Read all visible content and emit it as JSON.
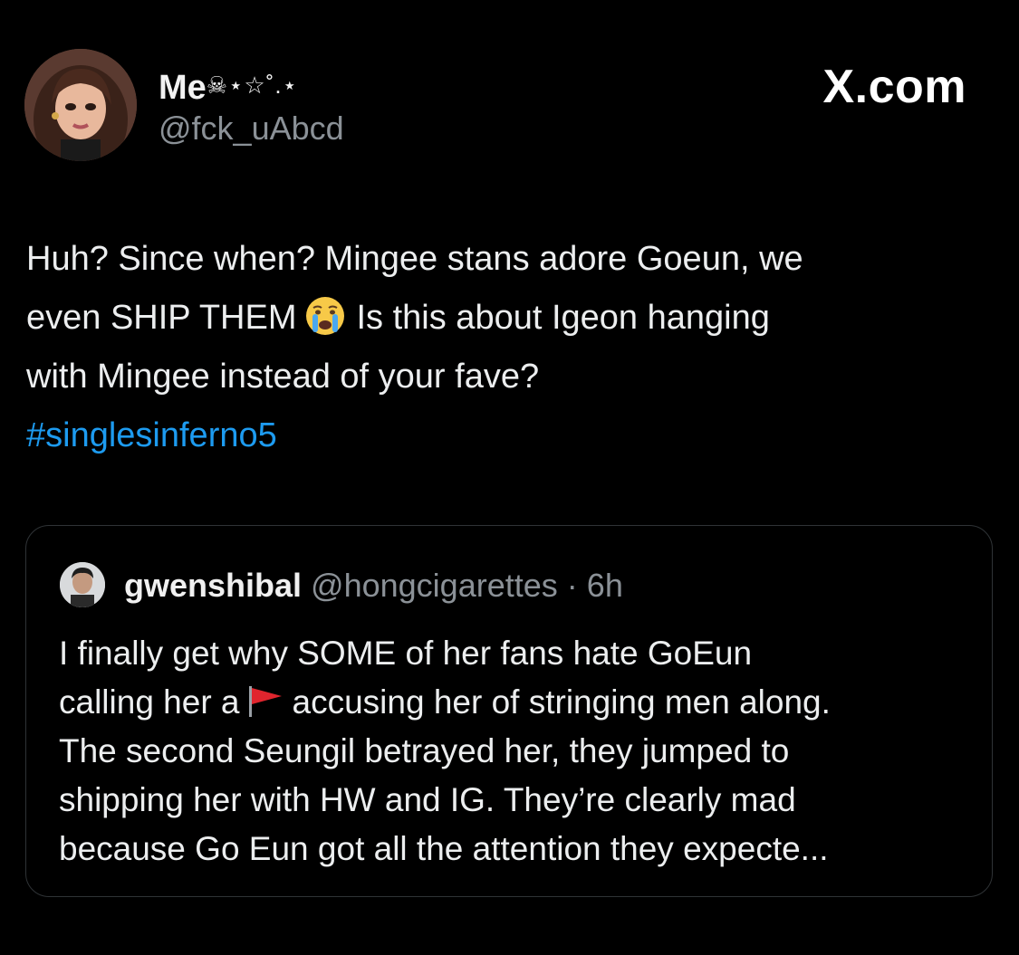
{
  "author": {
    "display_name": "Me",
    "display_name_decoration": "☠⋆☆˚.⋆",
    "handle": "@fck_uAbcd"
  },
  "brand": "X.com",
  "tweet": {
    "line1": "Huh? Since when? Mingee stans adore Goeun, we",
    "line2_before": "even SHIP THEM",
    "line2_after": "Is this about Igeon hanging",
    "line3": "with Mingee instead of your fave?",
    "hashtag": "#singlesinferno5"
  },
  "quoted": {
    "name": "gwenshibal",
    "handle": "@hongcigarettes",
    "separator": "·",
    "time": "6h",
    "line1": "I finally get why SOME of her fans hate GoEun",
    "line2_before": "calling her a",
    "line2_after": "accusing her of stringing men along.",
    "line3": "The second Seungil betrayed her, they jumped to",
    "line4": "shipping her with HW and IG. They’re clearly mad",
    "line5": "because Go Eun got all the attention they expecte..."
  },
  "colors": {
    "background": "#000000",
    "hashtag": "#1d9bf0",
    "muted": "#8b9197",
    "border": "#2f3336"
  },
  "icons": [
    "avatar",
    "crying-face-emoji-icon",
    "red-flag-emoji-icon",
    "quote-avatar"
  ]
}
